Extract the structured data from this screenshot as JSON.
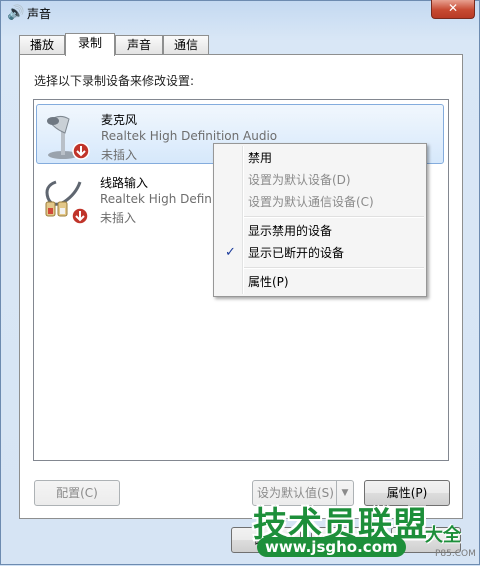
{
  "window": {
    "title": "声音",
    "close_glyph": "✕"
  },
  "tabs": [
    {
      "label": "播放",
      "active": false
    },
    {
      "label": "录制",
      "active": true
    },
    {
      "label": "声音",
      "active": false
    },
    {
      "label": "通信",
      "active": false
    }
  ],
  "panel": {
    "instruction": "选择以下录制设备来修改设置:",
    "devices": [
      {
        "name": "麦克风",
        "description": "Realtek High Definition Audio",
        "status": "未插入",
        "icon": "microphone-icon",
        "selected": true
      },
      {
        "name": "线路输入",
        "description": "Realtek High Definition Audio",
        "status": "未插入",
        "icon": "line-in-cable-icon",
        "selected": false
      }
    ]
  },
  "buttons": {
    "configure": "配置(C)",
    "set_default": "设为默认值(S)",
    "set_default_arrow": "▼",
    "properties": "属性(P)",
    "ok": "确定"
  },
  "context_menu": {
    "items": [
      {
        "label": "禁用",
        "enabled": true,
        "checked": false
      },
      {
        "label": "设置为默认设备(D)",
        "enabled": false,
        "checked": false
      },
      {
        "label": "设置为默认通信设备(C)",
        "enabled": false,
        "checked": false
      },
      {
        "label": "显示禁用的设备",
        "enabled": true,
        "checked": false
      },
      {
        "label": "显示已断开的设备",
        "enabled": true,
        "checked": true
      },
      {
        "label": "属性(P)",
        "enabled": true,
        "checked": false
      }
    ],
    "check_glyph": "✓"
  },
  "watermark": {
    "title": "技术员联盟",
    "side": "大全",
    "url": "www.jsgho.com",
    "tiny": "P85.COM"
  },
  "colors": {
    "selection_border": "#84acdd",
    "watermark_green": "#1d8f3a",
    "close_red": "#c74a32"
  }
}
